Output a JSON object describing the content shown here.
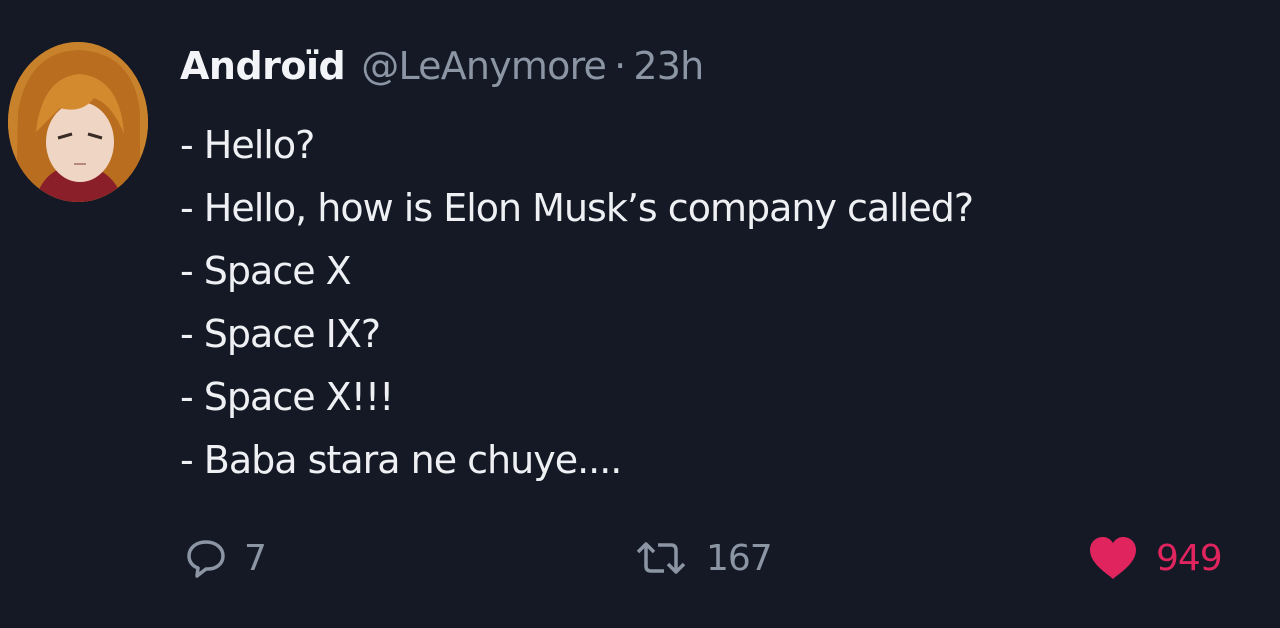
{
  "tweet": {
    "author": {
      "display_name": "Androïd",
      "handle": "@LeAnymore"
    },
    "separator": "·",
    "time": "23h",
    "lines": [
      "- Hello?",
      "- Hello, how is Elon Musk’s company called?",
      "- Space X",
      "- Space IX?",
      "- Space X!!!",
      "- Baba stara ne chuye...."
    ],
    "actions": {
      "reply": {
        "icon": "reply-icon",
        "count": "7"
      },
      "retweet": {
        "icon": "retweet-icon",
        "count": "167"
      },
      "like": {
        "icon": "heart-icon",
        "count": "949",
        "liked": true
      }
    }
  },
  "colors": {
    "background": "#141925",
    "text": "#eef0f3",
    "muted": "#8b95a3",
    "like": "#e0245e"
  }
}
